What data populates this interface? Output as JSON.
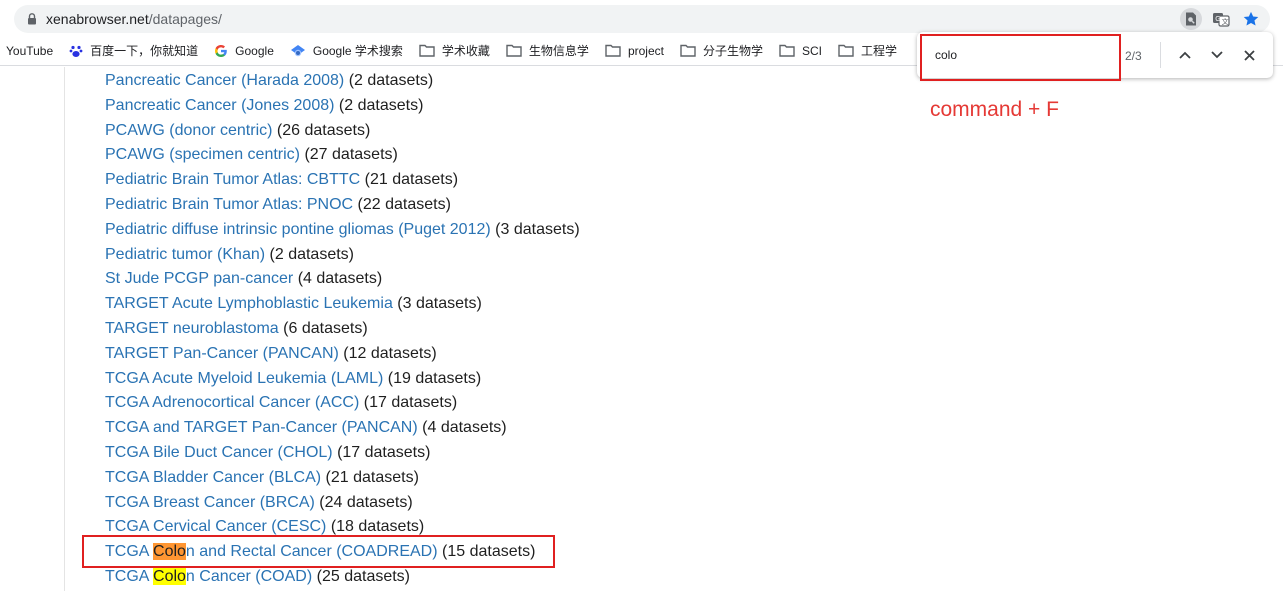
{
  "browser": {
    "url_host": "xenabrowser.net",
    "url_path": "/datapages/"
  },
  "bookmarks": [
    {
      "label": "YouTube",
      "icon": "none"
    },
    {
      "label": "百度一下，你就知道",
      "icon": "baidu-icon"
    },
    {
      "label": "Google",
      "icon": "google-icon"
    },
    {
      "label": "Google 学术搜索",
      "icon": "scholar-icon"
    },
    {
      "label": "学术收藏",
      "icon": "folder-icon"
    },
    {
      "label": "生物信息学",
      "icon": "folder-icon"
    },
    {
      "label": "project",
      "icon": "folder-icon"
    },
    {
      "label": "分子生物学",
      "icon": "folder-icon"
    },
    {
      "label": "SCI",
      "icon": "folder-icon"
    },
    {
      "label": "工程学",
      "icon": "folder-icon"
    }
  ],
  "find": {
    "query": "colo",
    "count": "2/3"
  },
  "annotation": {
    "text": "command + F"
  },
  "cohorts": [
    {
      "name": "Pancreatic Cancer (Harada 2008)",
      "count": "(2 datasets)"
    },
    {
      "name": "Pancreatic Cancer (Jones 2008)",
      "count": "(2 datasets)"
    },
    {
      "name": "PCAWG (donor centric)",
      "count": "(26 datasets)"
    },
    {
      "name": "PCAWG (specimen centric)",
      "count": "(27 datasets)"
    },
    {
      "name": "Pediatric Brain Tumor Atlas: CBTTC",
      "count": "(21 datasets)"
    },
    {
      "name": "Pediatric Brain Tumor Atlas: PNOC",
      "count": "(22 datasets)"
    },
    {
      "name": "Pediatric diffuse intrinsic pontine gliomas (Puget 2012)",
      "count": "(3 datasets)"
    },
    {
      "name": "Pediatric tumor (Khan)",
      "count": "(2 datasets)"
    },
    {
      "name": "St Jude PCGP pan-cancer",
      "count": "(4 datasets)"
    },
    {
      "name": "TARGET Acute Lymphoblastic Leukemia",
      "count": "(3 datasets)"
    },
    {
      "name": "TARGET neuroblastoma",
      "count": "(6 datasets)"
    },
    {
      "name": "TARGET Pan-Cancer (PANCAN)",
      "count": "(12 datasets)"
    },
    {
      "name": "TCGA Acute Myeloid Leukemia (LAML)",
      "count": "(19 datasets)"
    },
    {
      "name": "TCGA Adrenocortical Cancer (ACC)",
      "count": "(17 datasets)"
    },
    {
      "name": "TCGA and TARGET Pan-Cancer (PANCAN)",
      "count": "(4 datasets)"
    },
    {
      "name": "TCGA Bile Duct Cancer (CHOL)",
      "count": "(17 datasets)"
    },
    {
      "name": "TCGA Bladder Cancer (BLCA)",
      "count": "(21 datasets)"
    },
    {
      "name": "TCGA Breast Cancer (BRCA)",
      "count": "(24 datasets)"
    },
    {
      "name": "TCGA Cervical Cancer (CESC)",
      "count": "(18 datasets)"
    },
    {
      "name_pre": "TCGA ",
      "name_match": "Colo",
      "name_post": "n and Rectal Cancer (COADREAD)",
      "count": "(15 datasets)",
      "match": "current"
    },
    {
      "name_pre": "TCGA ",
      "name_match": "Colo",
      "name_post": "n Cancer (COAD)",
      "count": "(25 datasets)",
      "match": "other"
    }
  ]
}
